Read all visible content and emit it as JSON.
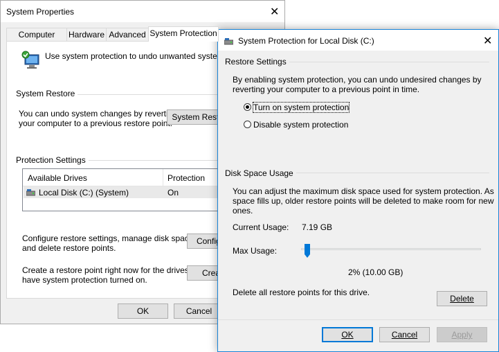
{
  "back_window": {
    "title": "System Properties",
    "tabs": [
      "Computer Name",
      "Hardware",
      "Advanced",
      "System Protection"
    ],
    "intro_text": "Use system protection to undo unwanted system changes.",
    "system_restore": {
      "heading": "System Restore",
      "description": "You can undo system changes by reverting\nyour computer to a previous restore point.",
      "button": "System Restore..."
    },
    "protection_settings": {
      "heading": "Protection Settings",
      "columns": [
        "Available Drives",
        "Protection"
      ],
      "rows": [
        {
          "drive": "Local Disk (C:) (System)",
          "protection": "On"
        }
      ]
    },
    "configure": {
      "description": "Configure restore settings, manage disk space,\nand delete restore points.",
      "button": "Configure..."
    },
    "create": {
      "description": "Create a restore point right now for the drives that\nhave system protection turned on.",
      "button": "Create..."
    },
    "footer": {
      "ok": "OK",
      "cancel": "Cancel"
    }
  },
  "front_window": {
    "title": "System Protection for Local Disk (C:)",
    "restore_settings": {
      "heading": "Restore Settings",
      "description": "By enabling system protection, you can undo undesired changes by\nreverting your computer to a previous point in time.",
      "option_on": "Turn on system protection",
      "option_off": "Disable system protection",
      "selected": "on"
    },
    "disk_space": {
      "heading": "Disk Space Usage",
      "description": "You can adjust the maximum disk space used for system protection. As\nspace fills up, older restore points will be deleted to make room for new\nones.",
      "current_label": "Current Usage:",
      "current_value": "7.19 GB",
      "max_label": "Max Usage:",
      "max_value": "2% (10.00 GB)",
      "slider_fraction": 0.02
    },
    "delete": {
      "description": "Delete all restore points for this drive.",
      "button": "Delete"
    },
    "footer": {
      "ok": "OK",
      "cancel": "Cancel",
      "apply": "Apply"
    }
  },
  "colors": {
    "accent": "#0078d7",
    "border_active": "#1883d7"
  },
  "icons": [
    "close-icon",
    "system-protection-icon",
    "drive-icon"
  ]
}
